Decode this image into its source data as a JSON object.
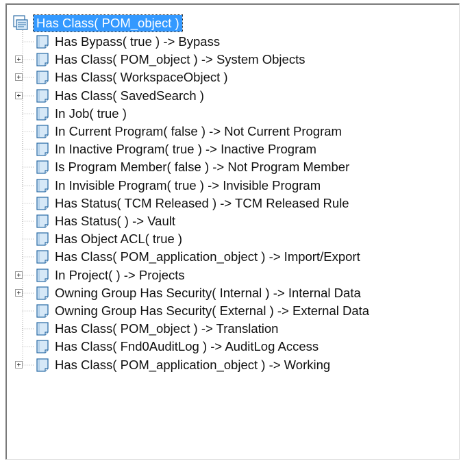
{
  "tree": {
    "root": {
      "label": "Has Class( POM_object )",
      "selected": true
    },
    "nodes": [
      {
        "label": "Has Bypass( true ) -> Bypass",
        "expandable": false
      },
      {
        "label": "Has Class( POM_object ) -> System Objects",
        "expandable": true
      },
      {
        "label": "Has Class( WorkspaceObject )",
        "expandable": true
      },
      {
        "label": "Has Class( SavedSearch )",
        "expandable": true
      },
      {
        "label": "In Job( true )",
        "expandable": false
      },
      {
        "label": "In Current Program( false ) -> Not Current Program",
        "expandable": false
      },
      {
        "label": "In Inactive Program( true ) -> Inactive Program",
        "expandable": false
      },
      {
        "label": "Is Program Member( false ) -> Not Program Member",
        "expandable": false
      },
      {
        "label": "In Invisible Program( true ) -> Invisible Program",
        "expandable": false
      },
      {
        "label": "Has Status( TCM Released ) -> TCM Released Rule",
        "expandable": false
      },
      {
        "label": "Has Status( ) -> Vault",
        "expandable": false
      },
      {
        "label": "Has Object ACL( true )",
        "expandable": false
      },
      {
        "label": "Has Class( POM_application_object ) -> Import/Export",
        "expandable": false
      },
      {
        "label": "In Project( ) -> Projects",
        "expandable": true
      },
      {
        "label": "Owning Group Has Security( Internal ) -> Internal Data",
        "expandable": true
      },
      {
        "label": "Owning Group Has Security( External ) -> External Data",
        "expandable": false
      },
      {
        "label": "Has Class( POM_object ) -> Translation",
        "expandable": false
      },
      {
        "label": "Has Class( Fnd0AuditLog ) -> AuditLog Access",
        "expandable": false
      },
      {
        "label": "Has Class( POM_application_object ) -> Working",
        "expandable": true
      }
    ]
  },
  "colors": {
    "selection": "#3399ff",
    "tree_line": "#a0a0a0",
    "icon_fill": "#d6e8f7",
    "icon_stroke": "#2f6fa8"
  }
}
